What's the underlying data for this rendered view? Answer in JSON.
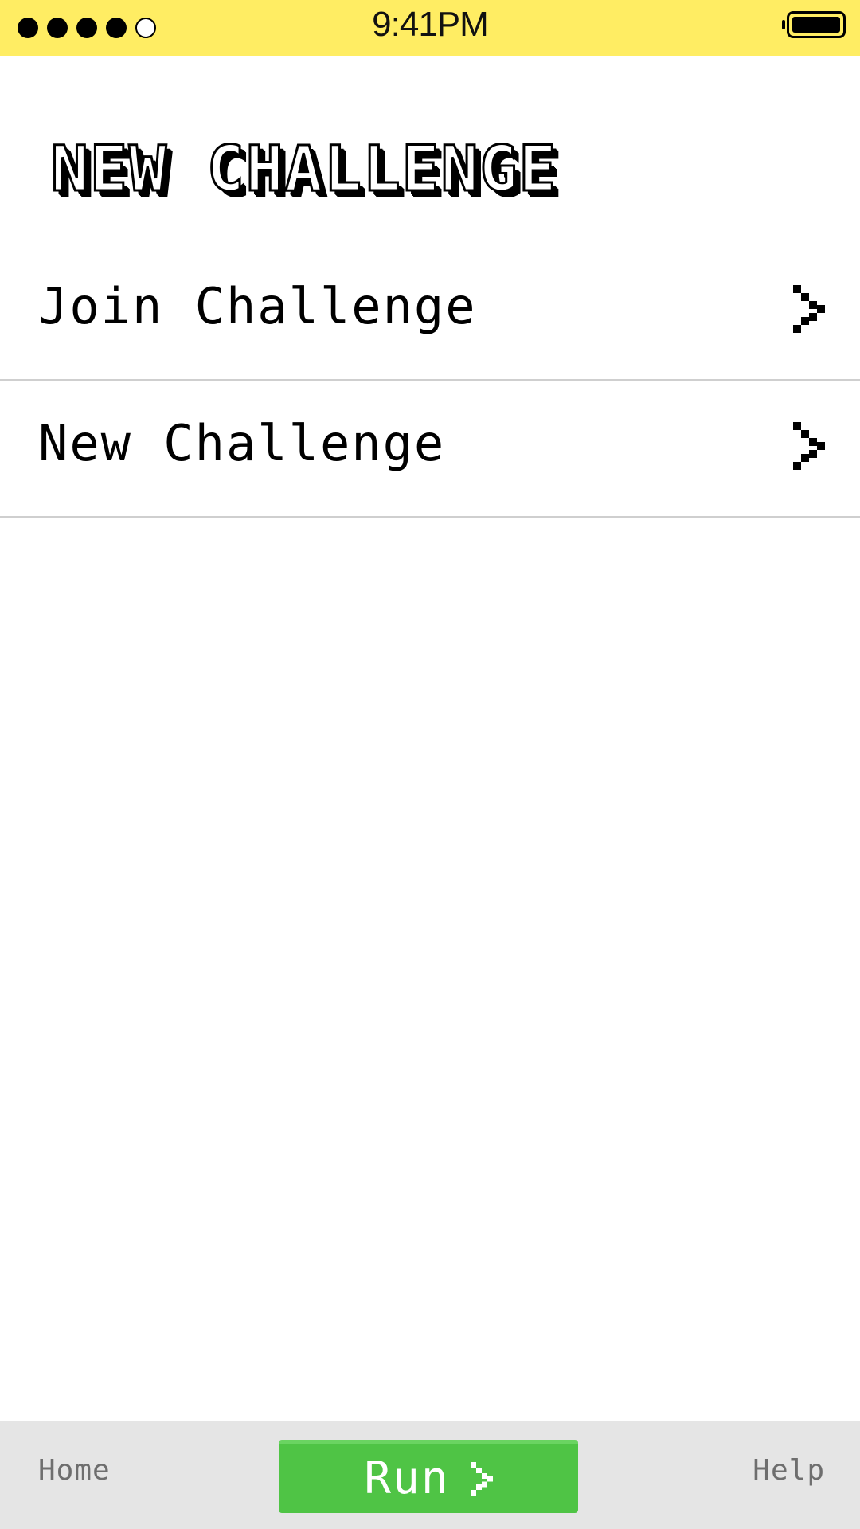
{
  "status_bar": {
    "time": "9:41PM",
    "signal_bars_filled": 4,
    "signal_bars_total": 5
  },
  "header": {
    "title": "NEW CHALLENGE"
  },
  "menu": {
    "items": [
      {
        "label": "Join Challenge",
        "icon": "chevron-right-icon"
      },
      {
        "label": "New Challenge",
        "icon": "chevron-right-icon"
      }
    ]
  },
  "bottom_nav": {
    "home_label": "Home",
    "run_label": "Run",
    "help_label": "Help"
  },
  "colors": {
    "status_bar": "#ffed63",
    "run_button": "#4fc445",
    "bottom_bar": "#e5e5e5",
    "divider": "#cfcfcf"
  }
}
